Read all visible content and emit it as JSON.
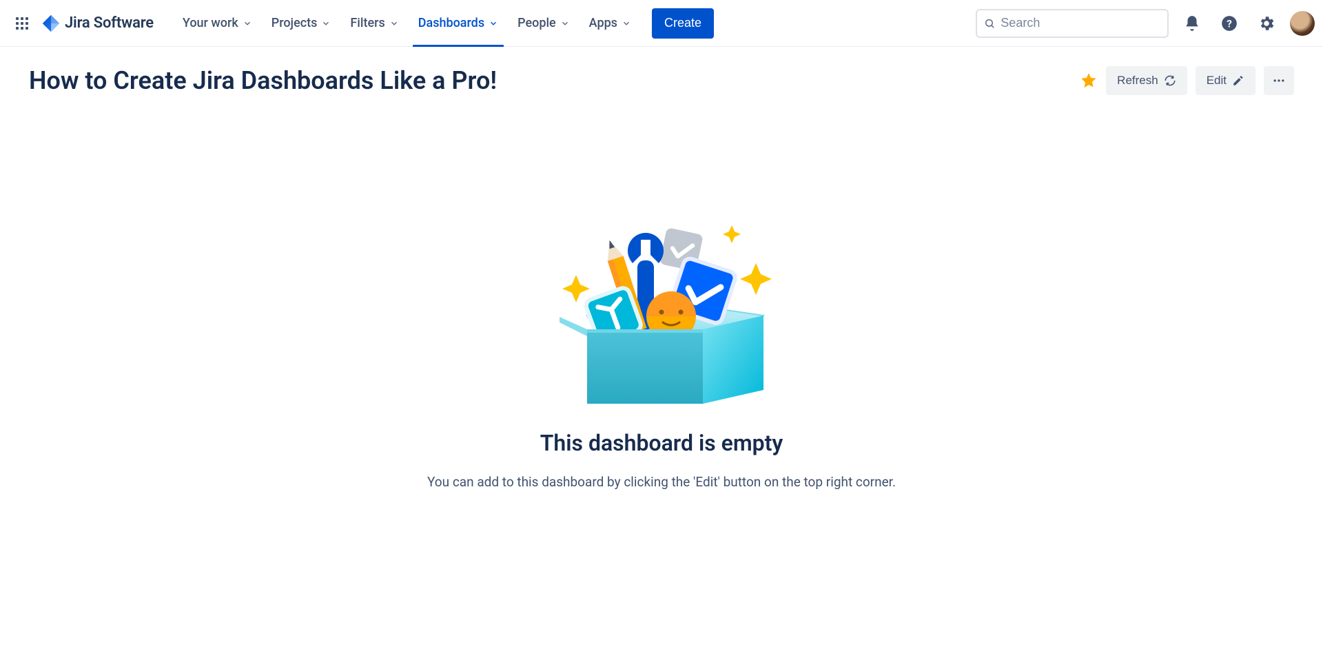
{
  "product_name": "Jira Software",
  "nav": {
    "items": [
      {
        "label": "Your work",
        "active": false
      },
      {
        "label": "Projects",
        "active": false
      },
      {
        "label": "Filters",
        "active": false
      },
      {
        "label": "Dashboards",
        "active": true
      },
      {
        "label": "People",
        "active": false
      },
      {
        "label": "Apps",
        "active": false
      }
    ],
    "create_label": "Create",
    "search_placeholder": "Search"
  },
  "page": {
    "title": "How to Create Jira Dashboards Like a Pro!",
    "starred": true,
    "actions": {
      "refresh_label": "Refresh",
      "edit_label": "Edit"
    },
    "empty_state": {
      "title": "This dashboard is empty",
      "subtitle": "You can add to this dashboard by clicking the 'Edit' button on the top right corner."
    }
  },
  "colors": {
    "primary": "#0052CC",
    "text": "#172B4D",
    "subtle": "#42526E",
    "star": "#FFAB00"
  }
}
